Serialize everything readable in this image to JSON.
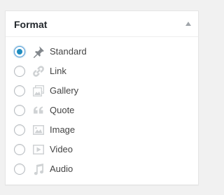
{
  "panel": {
    "title": "Format"
  },
  "formats": [
    {
      "label": "Standard",
      "icon": "pin-icon",
      "checked": true
    },
    {
      "label": "Link",
      "icon": "link-icon",
      "checked": false
    },
    {
      "label": "Gallery",
      "icon": "gallery-icon",
      "checked": false
    },
    {
      "label": "Quote",
      "icon": "quote-icon",
      "checked": false
    },
    {
      "label": "Image",
      "icon": "image-icon",
      "checked": false
    },
    {
      "label": "Video",
      "icon": "video-icon",
      "checked": false
    },
    {
      "label": "Audio",
      "icon": "audio-icon",
      "checked": false
    }
  ],
  "colors": {
    "accent": "#1e8cbe",
    "icon": "#82878c",
    "text": "#444444",
    "title": "#23282d"
  }
}
